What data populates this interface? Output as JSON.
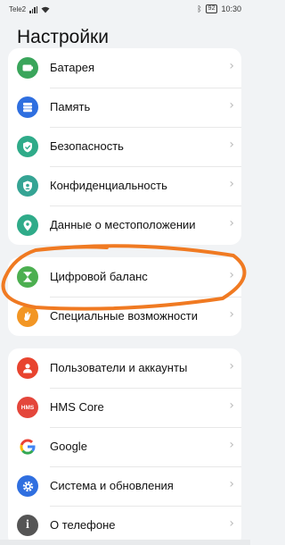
{
  "status_bar": {
    "carrier": "Tele2",
    "battery": "92",
    "time": "10:30"
  },
  "page_title": "Настройки",
  "groups": [
    {
      "items": [
        {
          "label": "Батарея",
          "icon": "battery-icon",
          "color": "#3aa55b"
        },
        {
          "label": "Память",
          "icon": "storage-icon",
          "color": "#2f6fe0"
        },
        {
          "label": "Безопасность",
          "icon": "shield-icon",
          "color": "#2fab89"
        },
        {
          "label": "Конфиденциальность",
          "icon": "privacy-icon",
          "color": "#35a494"
        },
        {
          "label": "Данные о местоположении",
          "icon": "location-icon",
          "color": "#2fab89"
        }
      ]
    },
    {
      "items": [
        {
          "label": "Цифровой баланс",
          "icon": "hourglass-icon",
          "color": "#4caf50"
        },
        {
          "label": "Специальные возможности",
          "icon": "accessibility-icon",
          "color": "#f29624"
        }
      ]
    },
    {
      "items": [
        {
          "label": "Пользователи и аккаунты",
          "icon": "user-icon",
          "color": "#e8442f"
        },
        {
          "label": "HMS Core",
          "icon": "hms-icon",
          "color": "#e4463b",
          "icon_text": "HMS"
        },
        {
          "label": "Google",
          "icon": "google-icon",
          "color": "#ffffff",
          "icon_text": "G"
        },
        {
          "label": "Система и обновления",
          "icon": "gear-icon",
          "color": "#2f6fe0"
        },
        {
          "label": "О телефоне",
          "icon": "info-icon",
          "color": "#555555",
          "icon_text": "i"
        }
      ]
    }
  ],
  "accent_colors": {
    "annotation_circle": "#f07a22"
  }
}
